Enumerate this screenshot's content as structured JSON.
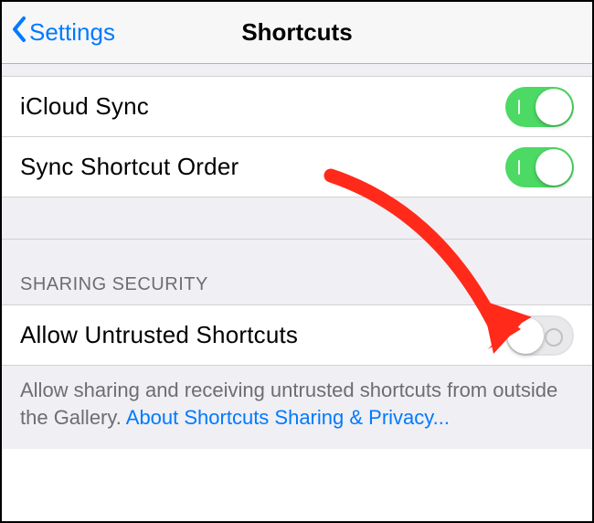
{
  "navbar": {
    "back_label": "Settings",
    "title": "Shortcuts"
  },
  "sync": {
    "icloud_label": "iCloud Sync",
    "order_label": "Sync Shortcut Order"
  },
  "sharing": {
    "section_header": "SHARING SECURITY",
    "allow_untrusted_label": "Allow Untrusted Shortcuts",
    "footer_text": "Allow sharing and receiving untrusted shortcuts from outside the Gallery. ",
    "footer_link": "About Shortcuts Sharing & Privacy..."
  },
  "toggles": {
    "icloud_sync": true,
    "sync_order": true,
    "allow_untrusted": false
  },
  "annotation": {
    "arrow_color": "#ff2a1a"
  }
}
